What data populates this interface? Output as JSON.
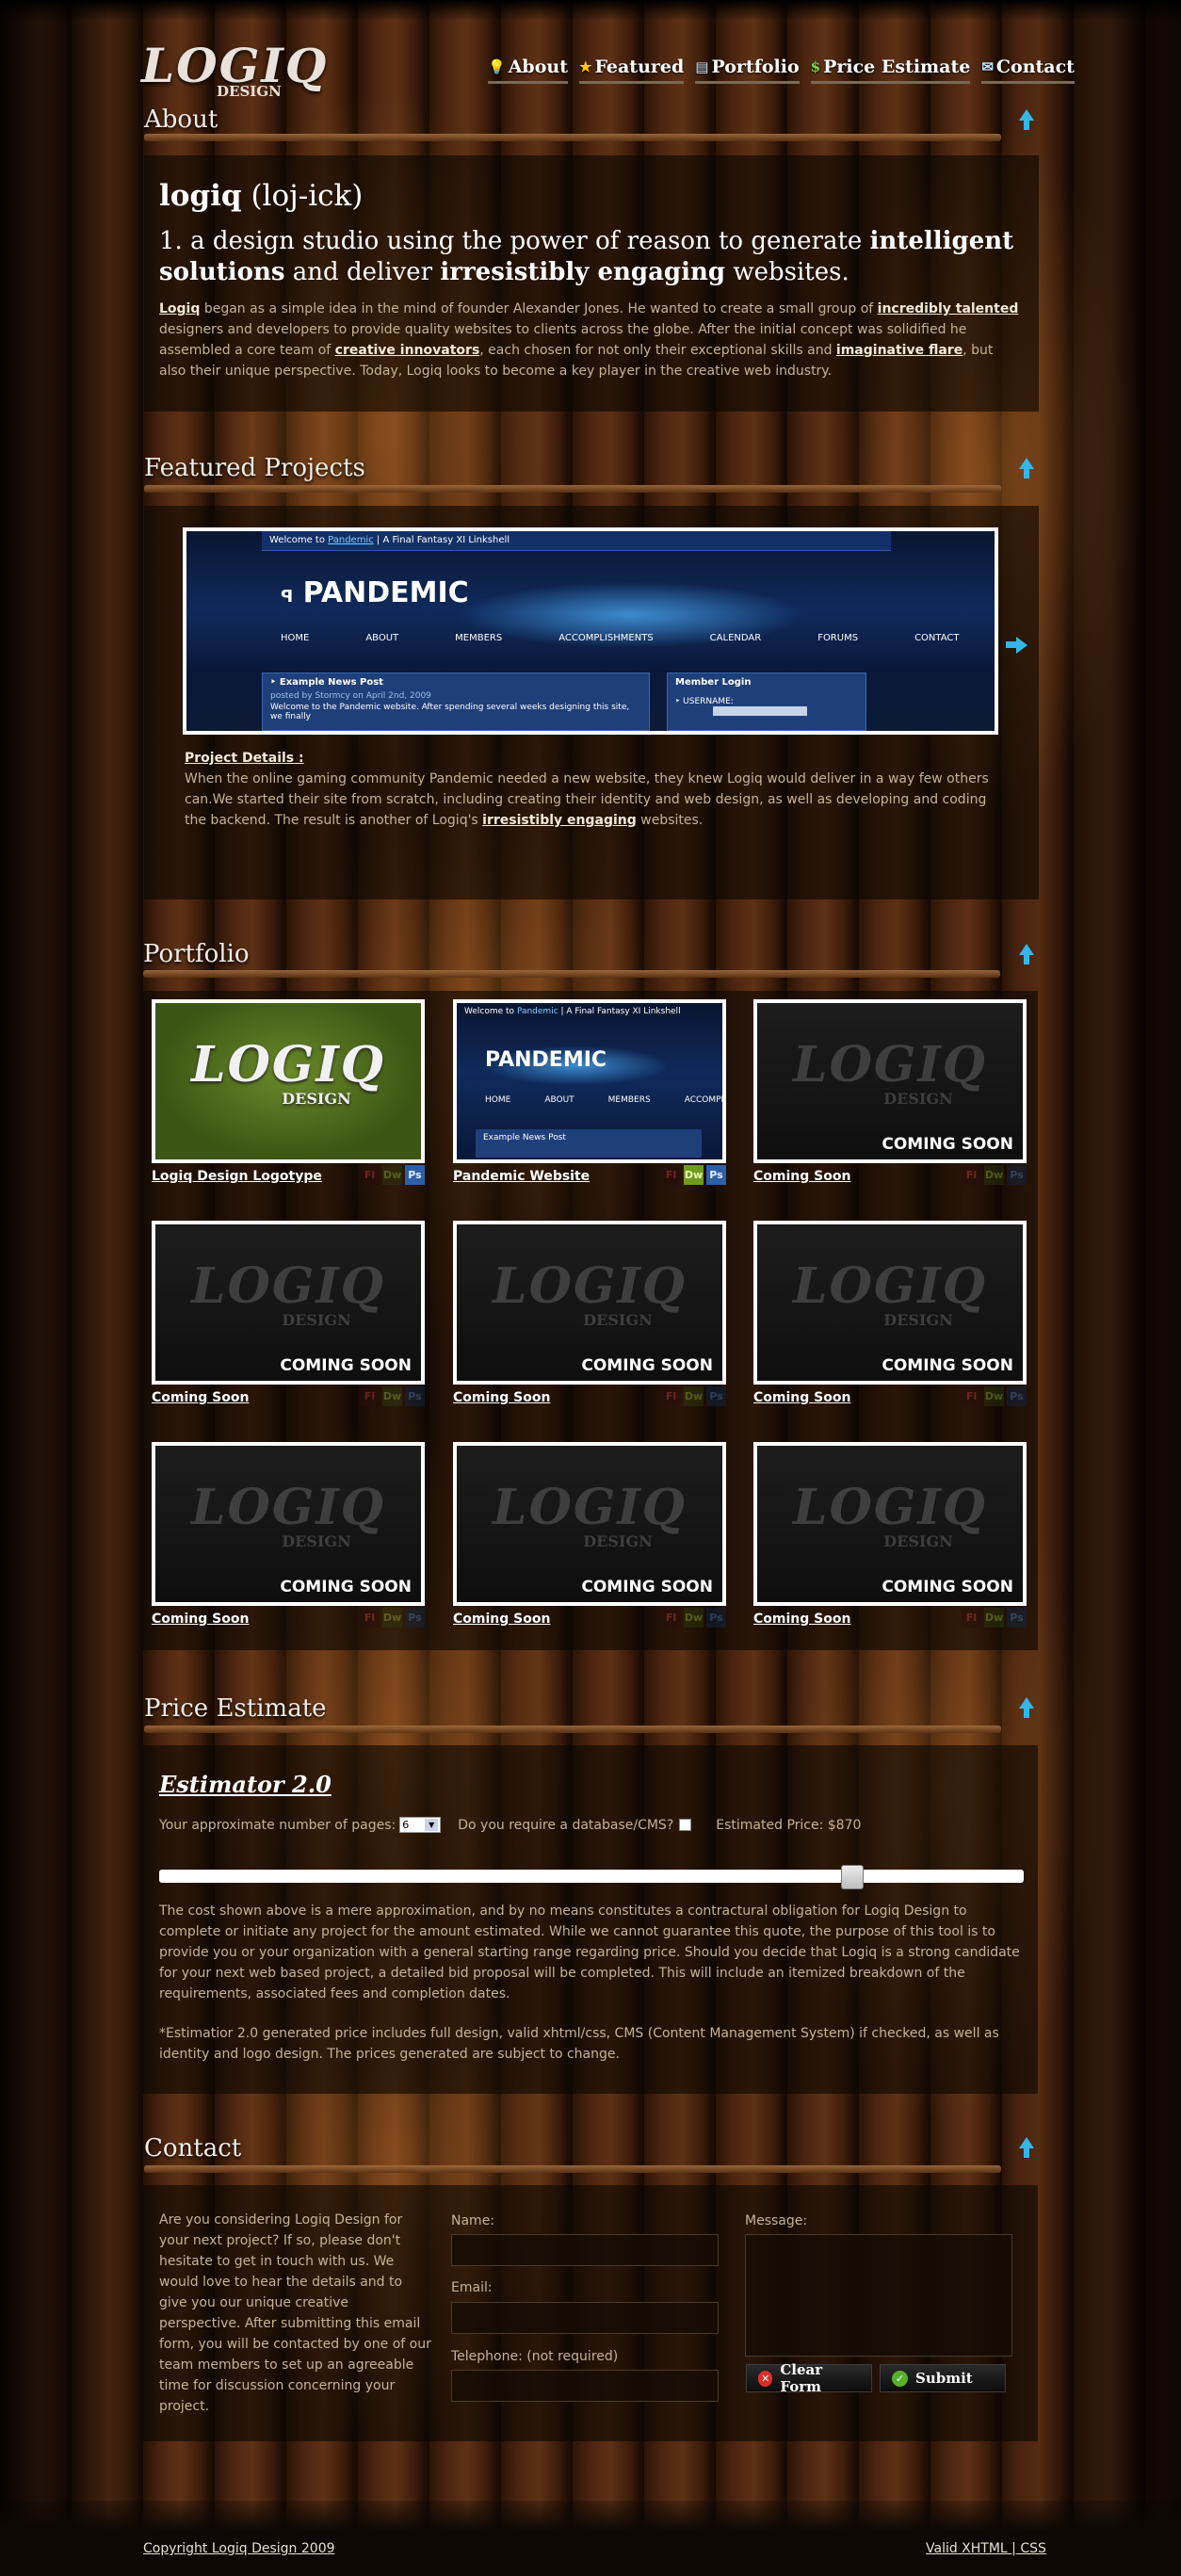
{
  "brand": {
    "logo_main": "LOGIQ",
    "logo_sub": "DESIGN"
  },
  "nav": [
    {
      "icon": "lightbulb-icon",
      "glyph": "💡",
      "label": "About"
    },
    {
      "icon": "star-icon",
      "glyph": "★",
      "label": "Featured"
    },
    {
      "icon": "picture-icon",
      "glyph": "▤",
      "label": "Portfolio"
    },
    {
      "icon": "dollar-icon",
      "glyph": "$",
      "label": "Price Estimate"
    },
    {
      "icon": "mail-icon",
      "glyph": "✉",
      "label": "Contact"
    }
  ],
  "about": {
    "title": "About",
    "word": "logiq",
    "pronunciation": "(loj-ick)",
    "def_1": "1. a design studio using the power of reason to generate ",
    "def_b1": "intelligent solutions",
    "def_2": " and deliver ",
    "def_b2": "irresistibly engaging",
    "def_3": " websites.",
    "p_link1": "Logiq",
    "p_1": " began as a simple idea in the mind of founder Alexander Jones. He wanted to create a small group of ",
    "p_link2": "incredibly talented",
    "p_2": " designers and developers to provide quality websites to clients across the globe. After the initial concept was solidified he assembled a core team of ",
    "p_link3": "creative innovators",
    "p_3": ", each chosen for not only their exceptional skills and ",
    "p_link4": "imaginative flare",
    "p_4": ", but also their unique perspective. Today, Logiq looks to become a key player in the creative web industry."
  },
  "featured": {
    "title": "Featured Projects",
    "shot": {
      "topbar_pre": "Welcome to ",
      "topbar_link": "Pandemic",
      "topbar_post": " | A Final Fantasy XI Linkshell",
      "brand": "PANDEMIC",
      "brand_badge": "ꟼ",
      "nav": [
        "HOME",
        "ABOUT",
        "MEMBERS",
        "ACCOMPLISHMENTS",
        "CALENDAR",
        "FORUMS",
        "CONTACT"
      ],
      "news_title": "Example News Post",
      "news_meta": "posted by Stormcy on April 2nd, 2009",
      "news_text": "Welcome to the Pandemic website. After spending several weeks designing this site, we finally",
      "login_title": "Member Login",
      "login_user": "USERNAME:"
    },
    "details_label": "Project Details :",
    "details_1": "When the online gaming community Pandemic needed a new website, they knew Logiq would deliver in a way few others can.We started their site from scratch, including creating their identity and web design, as well as developing and coding the backend. The result is another of Logiq's ",
    "details_link": "irresistibly engaging",
    "details_2": " websites."
  },
  "portfolio": {
    "title": "Portfolio",
    "items": [
      {
        "name": "Logiq Design Logotype",
        "thumb": "logo-green",
        "soon": "",
        "fl": "Fl",
        "dw": "Dw",
        "ps": "Ps",
        "dw_on": false,
        "ps_on": true
      },
      {
        "name": "Pandemic Website",
        "thumb": "pandemic",
        "soon": "",
        "fl": "Fl",
        "dw": "Dw",
        "ps": "Ps",
        "dw_on": true,
        "ps_on": true
      },
      {
        "name": "Coming Soon",
        "thumb": "soon",
        "soon": "COMING SOON",
        "fl": "Fl",
        "dw": "Dw",
        "ps": "Ps",
        "dw_on": false,
        "ps_on": false
      },
      {
        "name": "Coming Soon",
        "thumb": "soon",
        "soon": "COMING SOON",
        "fl": "Fl",
        "dw": "Dw",
        "ps": "Ps",
        "dw_on": false,
        "ps_on": false
      },
      {
        "name": "Coming Soon",
        "thumb": "soon",
        "soon": "COMING SOON",
        "fl": "Fl",
        "dw": "Dw",
        "ps": "Ps",
        "dw_on": false,
        "ps_on": false
      },
      {
        "name": "Coming Soon",
        "thumb": "soon",
        "soon": "COMING SOON",
        "fl": "Fl",
        "dw": "Dw",
        "ps": "Ps",
        "dw_on": false,
        "ps_on": false
      },
      {
        "name": "Coming Soon",
        "thumb": "soon",
        "soon": "COMING SOON",
        "fl": "Fl",
        "dw": "Dw",
        "ps": "Ps",
        "dw_on": false,
        "ps_on": false
      },
      {
        "name": "Coming Soon",
        "thumb": "soon",
        "soon": "COMING SOON",
        "fl": "Fl",
        "dw": "Dw",
        "ps": "Ps",
        "dw_on": false,
        "ps_on": false
      },
      {
        "name": "Coming Soon",
        "thumb": "soon",
        "soon": "COMING SOON",
        "fl": "Fl",
        "dw": "Dw",
        "ps": "Ps",
        "dw_on": false,
        "ps_on": false
      }
    ]
  },
  "estimate": {
    "title": "Price Estimate",
    "tool_name": "Estimator 2.0",
    "pages_label": "Your approximate number of pages:",
    "pages_value": "6",
    "db_label": "Do you require a database/CMS?",
    "db_checked": false,
    "price_label": "Estimated Price: $870",
    "slider_fraction": 0.81,
    "disclaimer": "The cost shown above is a mere approximation, and by no means constitutes a contractural obligation for Logiq Design to complete or initiate any project for the amount estimated. While we cannot guarantee this quote, the purpose of this tool is to provide you or your organization with a general starting range regarding price. Should you decide that Logiq is a strong candidate for your next web based project, a detailed bid proposal will be completed. This will include an itemized breakdown of the requirements, associated fees and completion dates.",
    "footnote": "*Estimatior 2.0 generated price includes full design, valid xhtml/css, CMS (Content Management System) if checked, as well as identity and logo design. The prices generated are subject to change."
  },
  "contact": {
    "title": "Contact",
    "intro": "Are you considering Logiq Design for your next project? If so, please don't hesitate to get in touch with us. We would love to hear the details and to give you our unique creative perspective. After submitting this email form, you will be contacted by one of our team members to set up an agreeable time for discussion concerning your project.",
    "name_label": "Name:",
    "email_label": "Email:",
    "phone_label": "Telephone: (not required)",
    "message_label": "Message:",
    "clear_label": "Clear Form",
    "submit_label": "Submit"
  },
  "footer": {
    "copyright": "Copyright Logiq Design 2009",
    "valid": "Valid XHTML | CSS"
  },
  "colors": {
    "accent": "#35b6e8",
    "panel": "#0c0602",
    "link": "#f4ead8"
  }
}
